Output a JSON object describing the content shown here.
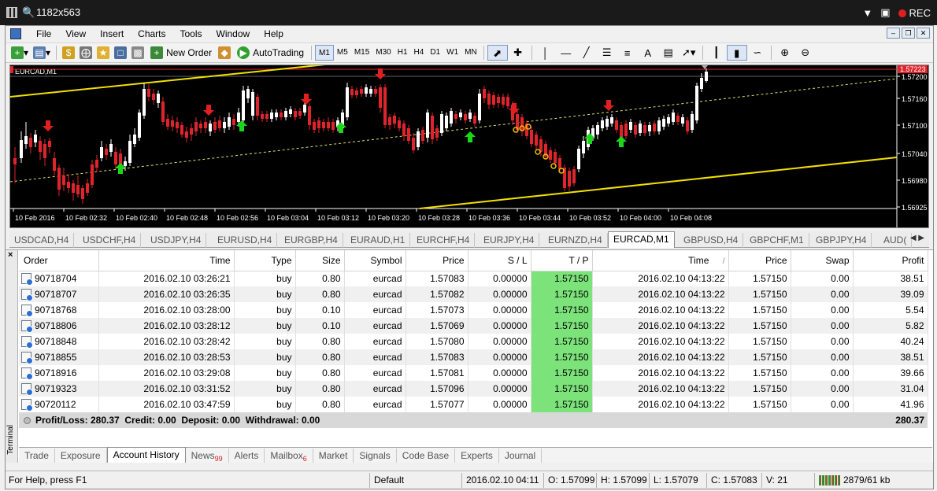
{
  "recorder": {
    "dims": "1182x563",
    "rec_label": "REC"
  },
  "menu": [
    "File",
    "View",
    "Insert",
    "Charts",
    "Tools",
    "Window",
    "Help"
  ],
  "toolbar": {
    "new_order": "New Order",
    "autotrading": "AutoTrading",
    "timeframes": [
      "M1",
      "M5",
      "M15",
      "M30",
      "H1",
      "H4",
      "D1",
      "W1",
      "MN"
    ],
    "selected_timeframe": "M1"
  },
  "chart": {
    "symbol_label": "EURCAD,M1",
    "current_price_red": "1.57223",
    "price_ticks": [
      "1.57200",
      "1.57160",
      "1.57100",
      "1.57040",
      "1.56980",
      "1.56925"
    ],
    "time_ticks": [
      "10 Feb 2016",
      "10 Feb 02:32",
      "10 Feb 02:40",
      "10 Feb 02:48",
      "10 Feb 02:56",
      "10 Feb 03:04",
      "10 Feb 03:12",
      "10 Feb 03:20",
      "10 Feb 03:28",
      "10 Feb 03:36",
      "10 Feb 03:44",
      "10 Feb 03:52",
      "10 Feb 04:00",
      "10 Feb 04:08"
    ],
    "colors": {
      "bull": "#ffffff",
      "bear": "#e0242c",
      "channel": "#f2e000",
      "midline": "#e8e070",
      "buy_arrow": "#18d818",
      "sell_arrow": "#e02020"
    }
  },
  "symbol_tabs": [
    "USDCAD,H4",
    "USDCHF,H4",
    "USDJPY,H4",
    "EURUSD,H4",
    "EURGBP,H4",
    "EURAUD,H1",
    "EURCHF,H4",
    "EURJPY,H4",
    "EURNZD,H4",
    "EURCAD,M1",
    "GBPUSD,H4",
    "GBPCHF,M1",
    "GBPJPY,H4",
    "AUD("
  ],
  "active_symbol_tab": "EURCAD,M1",
  "terminal": {
    "side_label": "Terminal",
    "columns": [
      "Order",
      "Time",
      "Type",
      "Size",
      "Symbol",
      "Price",
      "S / L",
      "T / P",
      "Time",
      "Price",
      "Swap",
      "Profit"
    ],
    "sort_indicator": "/",
    "rows": [
      [
        "90718704",
        "2016.02.10 03:26:21",
        "buy",
        "0.80",
        "eurcad",
        "1.57083",
        "0.00000",
        "1.57150",
        "2016.02.10 04:13:22",
        "1.57150",
        "0.00",
        "38.51"
      ],
      [
        "90718707",
        "2016.02.10 03:26:35",
        "buy",
        "0.80",
        "eurcad",
        "1.57082",
        "0.00000",
        "1.57150",
        "2016.02.10 04:13:22",
        "1.57150",
        "0.00",
        "39.09"
      ],
      [
        "90718768",
        "2016.02.10 03:28:00",
        "buy",
        "0.10",
        "eurcad",
        "1.57073",
        "0.00000",
        "1.57150",
        "2016.02.10 04:13:22",
        "1.57150",
        "0.00",
        "5.54"
      ],
      [
        "90718806",
        "2016.02.10 03:28:12",
        "buy",
        "0.10",
        "eurcad",
        "1.57069",
        "0.00000",
        "1.57150",
        "2016.02.10 04:13:22",
        "1.57150",
        "0.00",
        "5.82"
      ],
      [
        "90718848",
        "2016.02.10 03:28:42",
        "buy",
        "0.80",
        "eurcad",
        "1.57080",
        "0.00000",
        "1.57150",
        "2016.02.10 04:13:22",
        "1.57150",
        "0.00",
        "40.24"
      ],
      [
        "90718855",
        "2016.02.10 03:28:53",
        "buy",
        "0.80",
        "eurcad",
        "1.57083",
        "0.00000",
        "1.57150",
        "2016.02.10 04:13:22",
        "1.57150",
        "0.00",
        "38.51"
      ],
      [
        "90718916",
        "2016.02.10 03:29:08",
        "buy",
        "0.80",
        "eurcad",
        "1.57081",
        "0.00000",
        "1.57150",
        "2016.02.10 04:13:22",
        "1.57150",
        "0.00",
        "39.66"
      ],
      [
        "90719323",
        "2016.02.10 03:31:52",
        "buy",
        "0.80",
        "eurcad",
        "1.57096",
        "0.00000",
        "1.57150",
        "2016.02.10 04:13:22",
        "1.57150",
        "0.00",
        "31.04"
      ],
      [
        "90720112",
        "2016.02.10 03:47:59",
        "buy",
        "0.80",
        "eurcad",
        "1.57077",
        "0.00000",
        "1.57150",
        "2016.02.10 04:13:22",
        "1.57150",
        "0.00",
        "41.96"
      ]
    ],
    "summary_text": "Profit/Loss: 280.37  Credit: 0.00  Deposit: 0.00  Withdrawal: 0.00",
    "summary_total": "280.37",
    "tabs": [
      {
        "label": "Trade",
        "badge": ""
      },
      {
        "label": "Exposure",
        "badge": ""
      },
      {
        "label": "Account History",
        "badge": ""
      },
      {
        "label": "News",
        "badge": "99"
      },
      {
        "label": "Alerts",
        "badge": ""
      },
      {
        "label": "Mailbox",
        "badge": "6"
      },
      {
        "label": "Market",
        "badge": ""
      },
      {
        "label": "Signals",
        "badge": ""
      },
      {
        "label": "Code Base",
        "badge": ""
      },
      {
        "label": "Experts",
        "badge": ""
      },
      {
        "label": "Journal",
        "badge": ""
      }
    ],
    "active_tab": "Account History"
  },
  "status": {
    "help": "For Help, press F1",
    "profile": "Default",
    "datetime": "2016.02.10 04:11",
    "open": "O: 1.57099",
    "high": "H: 1.57099",
    "low": "L: 1.57079",
    "close": "C: 1.57083",
    "volume": "V: 21",
    "traffic": "2879/61 kb"
  }
}
